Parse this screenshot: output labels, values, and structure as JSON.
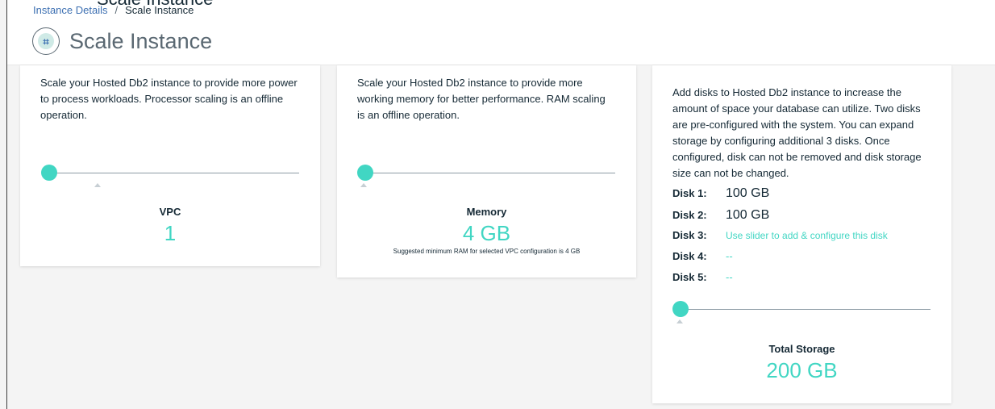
{
  "header": {
    "top_clipped_text": "Scale Instance",
    "breadcrumb": {
      "link": "Instance Details",
      "separator": "/",
      "current": "Scale Instance"
    },
    "title": "Scale Instance",
    "title_icon": "instance-hexagon-icon"
  },
  "processor": {
    "description": "Scale your Hosted Db2 instance to provide more power to process workloads. Processor scaling is an offline operation.",
    "label": "VPC",
    "value": "1",
    "slider_level": 0
  },
  "memory": {
    "description": "Scale your Hosted Db2 instance to provide more working memory for better performance. RAM scaling is an offline operation.",
    "label": "Memory",
    "value": "4 GB",
    "note": "Suggested minimum RAM for selected VPC configuration is 4 GB",
    "slider_level": 0
  },
  "storage": {
    "description": "Add disks to Hosted Db2 instance to increase the amount of space your database can utilize. Two disks are pre-configured with the system. You can expand storage by configuring additional 3 disks. Once configured, disk can not be removed and disk storage size can not be changed.",
    "disks": [
      {
        "label": "Disk 1:",
        "value": "100 GB"
      },
      {
        "label": "Disk 2:",
        "value": "100 GB"
      },
      {
        "label": "Disk 3:",
        "value": "Use slider to add & configure this disk"
      },
      {
        "label": "Disk 4:",
        "value": "--"
      },
      {
        "label": "Disk 5:",
        "value": "--"
      }
    ],
    "label": "Total Storage",
    "value": "200 GB",
    "slider_level": 0
  },
  "colors": {
    "accent": "#41d6c3",
    "link": "#3d70b2",
    "text": "#152935",
    "muted": "#5a6872"
  }
}
